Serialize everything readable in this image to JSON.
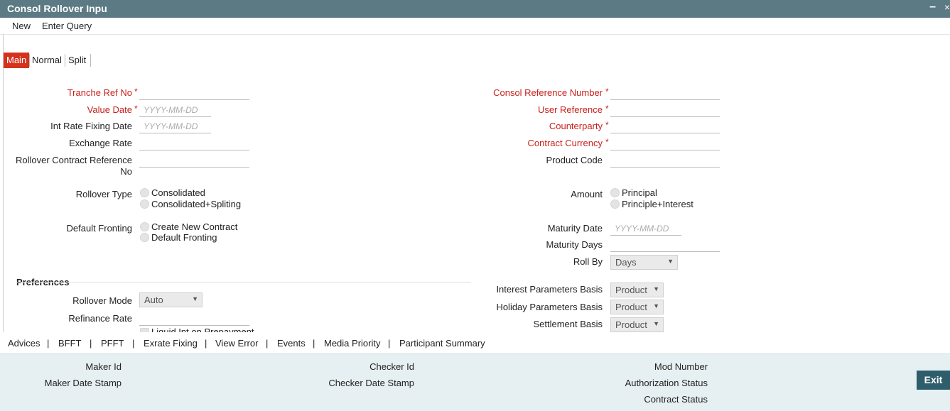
{
  "window": {
    "title": "Consol Rollover Inpu",
    "minimize": "–",
    "close": "×"
  },
  "menu": {
    "new": "New",
    "enter_query": "Enter Query"
  },
  "tabs": [
    "Main",
    "Normal",
    "Split"
  ],
  "left": {
    "tranche_ref_no": "Tranche Ref No",
    "value_date": "Value Date",
    "int_rate_fixing_date": "Int Rate Fixing Date",
    "exchange_rate": "Exchange Rate",
    "rollover_contract_ref_1": "Rollover Contract Reference",
    "rollover_contract_ref_2": "No",
    "rollover_type": "Rollover Type",
    "rollover_type_options": [
      "Consolidated",
      "Consolidated+Spliting"
    ],
    "default_fronting": "Default Fronting",
    "default_fronting_options": [
      "Create New Contract",
      "Default Fronting"
    ],
    "date_placeholder": "YYYY-MM-DD"
  },
  "right": {
    "consol_reference_number": "Consol Reference Number",
    "user_reference": "User Reference",
    "counterparty": "Counterparty",
    "contract_currency": "Contract Currency",
    "product_code": "Product Code",
    "amount": "Amount",
    "amount_options": [
      "Principal",
      "Principle+Interest"
    ],
    "maturity_date": "Maturity Date",
    "maturity_days": "Maturity Days",
    "roll_by": "Roll By",
    "roll_by_value": "Days",
    "interest_parameters_basis": "Interest Parameters Basis",
    "interest_parameters_basis_value": "Product",
    "holiday_parameters_basis": "Holiday Parameters Basis",
    "holiday_parameters_basis_value": "Product",
    "settlement_basis": "Settlement Basis",
    "settlement_basis_value": "Product"
  },
  "preferences": {
    "title": "Preferences",
    "rollover_mode": "Rollover Mode",
    "rollover_mode_value": "Auto",
    "refinance_rate": "Refinance Rate",
    "liquid_int_partial": "Liquid Int on Prepayment"
  },
  "links": [
    "Advices",
    "BFFT",
    "PFFT",
    "Exrate Fixing",
    "View Error",
    "Events",
    "Media Priority",
    "Participant Summary"
  ],
  "link_separator": "|",
  "footer": {
    "maker_id": "Maker Id",
    "maker_date_stamp": "Maker Date Stamp",
    "checker_id": "Checker Id",
    "checker_date_stamp": "Checker Date Stamp",
    "mod_number": "Mod Number",
    "authorization_status": "Authorization Status",
    "contract_status": "Contract Status",
    "exit": "Exit"
  },
  "required_marker": "*",
  "colors": {
    "titlebar": "#5b7a84",
    "active_tab": "#d4321e",
    "required": "#c8201c",
    "exit_button": "#2e5d6b",
    "footer": "#e6f0f2"
  }
}
